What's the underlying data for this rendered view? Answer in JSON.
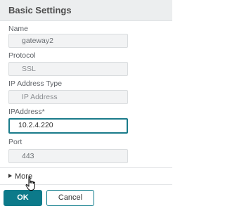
{
  "header": {
    "title": "Basic Settings"
  },
  "fields": {
    "name": {
      "label": "Name",
      "value": "gateway2"
    },
    "protocol": {
      "label": "Protocol",
      "value": "SSL"
    },
    "ip_type": {
      "label": "IP Address Type",
      "value": "IP Address"
    },
    "ip_address": {
      "label": "IPAddress*",
      "value": "10.2.4.220"
    },
    "port": {
      "label": "Port",
      "value": "443"
    }
  },
  "more": {
    "label": "More"
  },
  "buttons": {
    "ok": "OK",
    "cancel": "Cancel"
  },
  "colors": {
    "accent": "#0c7a8a",
    "header_bg": "#eceeef",
    "field_bg": "#f2f3f4"
  }
}
